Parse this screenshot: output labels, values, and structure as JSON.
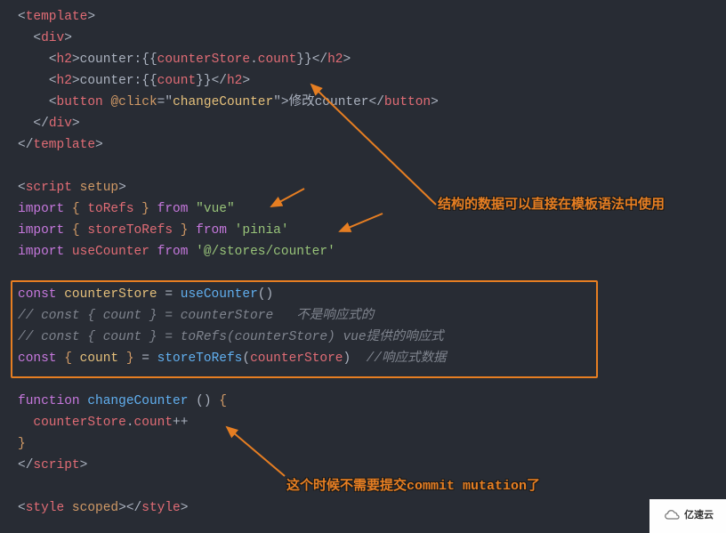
{
  "code": {
    "l1": {
      "open": "<",
      "tag": "template",
      "close": ">"
    },
    "l2": {
      "indent": "  ",
      "open": "<",
      "tag": "div",
      "close": ">"
    },
    "l3": {
      "indent": "    ",
      "open": "<",
      "tag": "h2",
      "gt": ">",
      "text": "counter:",
      "dopen": "{{",
      "obj": "counterStore",
      "dot": ".",
      "prop": "count",
      "dclose": "}}",
      "cOpen": "</",
      "cTag": "h2",
      "cClose": ">"
    },
    "l4": {
      "indent": "    ",
      "open": "<",
      "tag": "h2",
      "gt": ">",
      "text": "counter:",
      "dopen": "{{",
      "expr": "count",
      "dclose": "}}",
      "cOpen": "</",
      "cTag": "h2",
      "cClose": ">"
    },
    "l5": {
      "indent": "    ",
      "open": "<",
      "tag": "button",
      "sp": " ",
      "at": "@click",
      "eq": "=",
      "q1": "\"",
      "val": "changeCounter",
      "q2": "\"",
      "gt": ">",
      "text": "修改counter",
      "cOpen": "</",
      "cTag": "button",
      "cClose": ">"
    },
    "l6": {
      "indent": "  ",
      "open": "</",
      "tag": "div",
      "close": ">"
    },
    "l7": {
      "open": "</",
      "tag": "template",
      "close": ">"
    },
    "l8": "",
    "l9": {
      "open": "<",
      "tag": "script",
      "sp": " ",
      "attr": "setup",
      "close": ">"
    },
    "l10": {
      "kw": "import",
      "sp": " ",
      "b1": "{",
      "sp2": " ",
      "name": "toRefs",
      "sp3": " ",
      "b2": "}",
      "sp4": " ",
      "from": "from",
      "sp5": " ",
      "str": "\"vue\""
    },
    "l11": {
      "kw": "import",
      "sp": " ",
      "b1": "{",
      "sp2": " ",
      "name": "storeToRefs",
      "sp3": " ",
      "b2": "}",
      "sp4": " ",
      "from": "from",
      "sp5": " ",
      "str": "'pinia'"
    },
    "l12": {
      "kw": "import",
      "sp": " ",
      "name": "useCounter",
      "sp2": " ",
      "from": "from",
      "sp3": " ",
      "str": "'@/stores/counter'"
    },
    "l13": "",
    "l14": {
      "kw": "const",
      "sp": " ",
      "name": "counterStore",
      "sp2": " ",
      "eq": "=",
      "sp3": " ",
      "fn": "useCounter",
      "p": "()"
    },
    "l15": {
      "comment": "// const { count } = counterStore   不是响应式的"
    },
    "l16": {
      "comment": "// const { count } = toRefs(counterStore) vue提供的响应式"
    },
    "l17": {
      "kw": "const",
      "sp": " ",
      "b1": "{",
      "sp2": " ",
      "name": "count",
      "sp3": " ",
      "b2": "}",
      "sp4": " ",
      "eq": "=",
      "sp5": " ",
      "fn": "storeToRefs",
      "p1": "(",
      "arg": "counterStore",
      "p2": ")",
      "sp6": "  ",
      "comment": "//响应式数据"
    },
    "l18": "",
    "l19": {
      "kw": "function",
      "sp": " ",
      "name": "changeCounter",
      "sp2": " ",
      "p": "()",
      "sp3": " ",
      "b": "{"
    },
    "l20": {
      "indent": "  ",
      "obj": "counterStore",
      "dot": ".",
      "prop": "count",
      "op": "++"
    },
    "l21": {
      "b": "}"
    },
    "l22": {
      "open": "</",
      "tag": "script",
      "close": ">"
    },
    "l23": "",
    "l24": {
      "open": "<",
      "tag": "style",
      "sp": " ",
      "attr": "scoped",
      "close": ">",
      "cOpen": "</",
      "cTag": "style",
      "cClose": ">"
    }
  },
  "annotations": {
    "a1": "结构的数据可以直接在模板语法中使用",
    "a2": "这个时候不需要提交commit mutation了"
  },
  "logo_text": "亿速云"
}
